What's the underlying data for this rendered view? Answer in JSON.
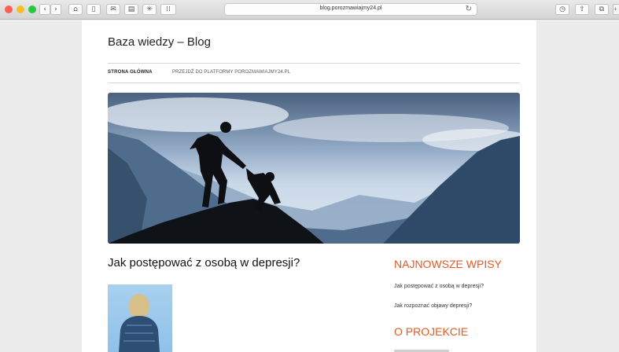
{
  "browser": {
    "url": "blog.porozmawiajmy24.pl",
    "colors": {
      "close": "#fc5f57",
      "minimize": "#fdbc2e",
      "zoom": "#28c840"
    },
    "toolbar_icons": [
      "back-icon",
      "forward-icon",
      "home-icon",
      "sidebar-icon",
      "mail-icon",
      "print-icon",
      "brightness-icon",
      "grid-icon",
      "reload-icon",
      "history-icon",
      "share-icon",
      "tabs-icon"
    ]
  },
  "site": {
    "title": "Baza wiedzy – Blog",
    "nav": [
      "STRONA GŁÓWNA",
      "PRZEJDŹ DO PLATFORMY POROZMAWIAJMY24.PL"
    ]
  },
  "post": {
    "title": "Jak postępować z osobą w depresji?"
  },
  "sidebar": {
    "recent_heading": "NAJNOWSZE WPISY",
    "recent_posts": [
      "Jak postępować z osobą w depresji?",
      "Jak rozpoznać objawy depresji?"
    ],
    "about_heading": "O PROJEKCIE",
    "accent_color": "#e8581e"
  }
}
